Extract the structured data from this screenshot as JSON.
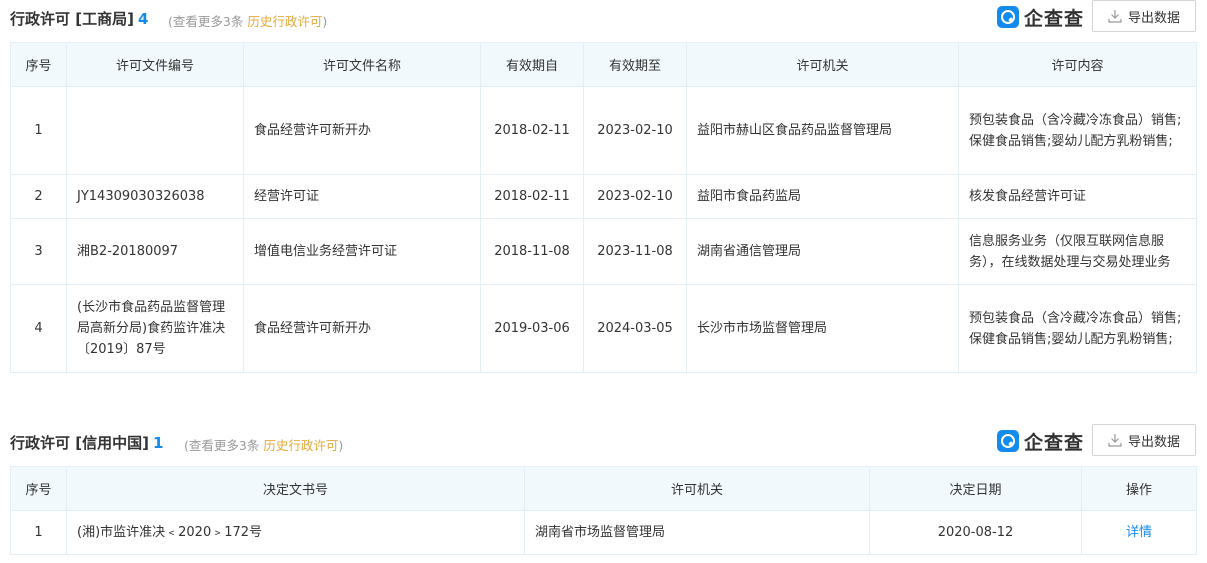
{
  "section1": {
    "title": "行政许可 [工商局]",
    "count": "4",
    "note_prefix": "(查看更多3条 ",
    "note_link": "历史行政许可",
    "note_suffix": ")",
    "brand": "企查查",
    "export_label": "导出数据",
    "columns": [
      "序号",
      "许可文件编号",
      "许可文件名称",
      "有效期自",
      "有效期至",
      "许可机关",
      "许可内容"
    ],
    "rows": [
      {
        "no": "1",
        "doc_no": "",
        "doc_name": "食品经营许可新开办",
        "from": "2018-02-11",
        "to": "2023-02-10",
        "authority": "益阳市赫山区食品药品监督管理局",
        "content": "预包装食品（含冷藏冷冻食品）销售;保健食品销售;婴幼儿配方乳粉销售;"
      },
      {
        "no": "2",
        "doc_no": "JY14309030326038",
        "doc_name": "经营许可证",
        "from": "2018-02-11",
        "to": "2023-02-10",
        "authority": "益阳市食品药监局",
        "content": "核发食品经营许可证"
      },
      {
        "no": "3",
        "doc_no": "湘B2-20180097",
        "doc_name": "增值电信业务经营许可证",
        "from": "2018-11-08",
        "to": "2023-11-08",
        "authority": "湖南省通信管理局",
        "content": "信息服务业务（仅限互联网信息服务），在线数据处理与交易处理业务"
      },
      {
        "no": "4",
        "doc_no": "(长沙市食品药品监督管理局高新分局)食药监许准决〔2019〕87号",
        "doc_name": "食品经营许可新开办",
        "from": "2019-03-06",
        "to": "2024-03-05",
        "authority": "长沙市市场监督管理局",
        "content": "预包装食品（含冷藏冷冻食品）销售;保健食品销售;婴幼儿配方乳粉销售;"
      }
    ]
  },
  "section2": {
    "title": "行政许可 [信用中国]",
    "count": "1",
    "note_prefix": "(查看更多3条 ",
    "note_link": "历史行政许可",
    "note_suffix": ")",
    "brand": "企查查",
    "export_label": "导出数据",
    "columns": [
      "序号",
      "决定文书号",
      "许可机关",
      "决定日期",
      "操作"
    ],
    "rows": [
      {
        "no": "1",
        "decision_no": "(湘)市监许准决﹤2020﹥172号",
        "authority": "湖南省市场监督管理局",
        "date": "2020-08-12",
        "action": "详情"
      }
    ]
  },
  "colors": {
    "accent": "#128bed",
    "history_link": "#e8a93a",
    "header_bg": "#f2f9fc",
    "border": "#e4eef6"
  }
}
